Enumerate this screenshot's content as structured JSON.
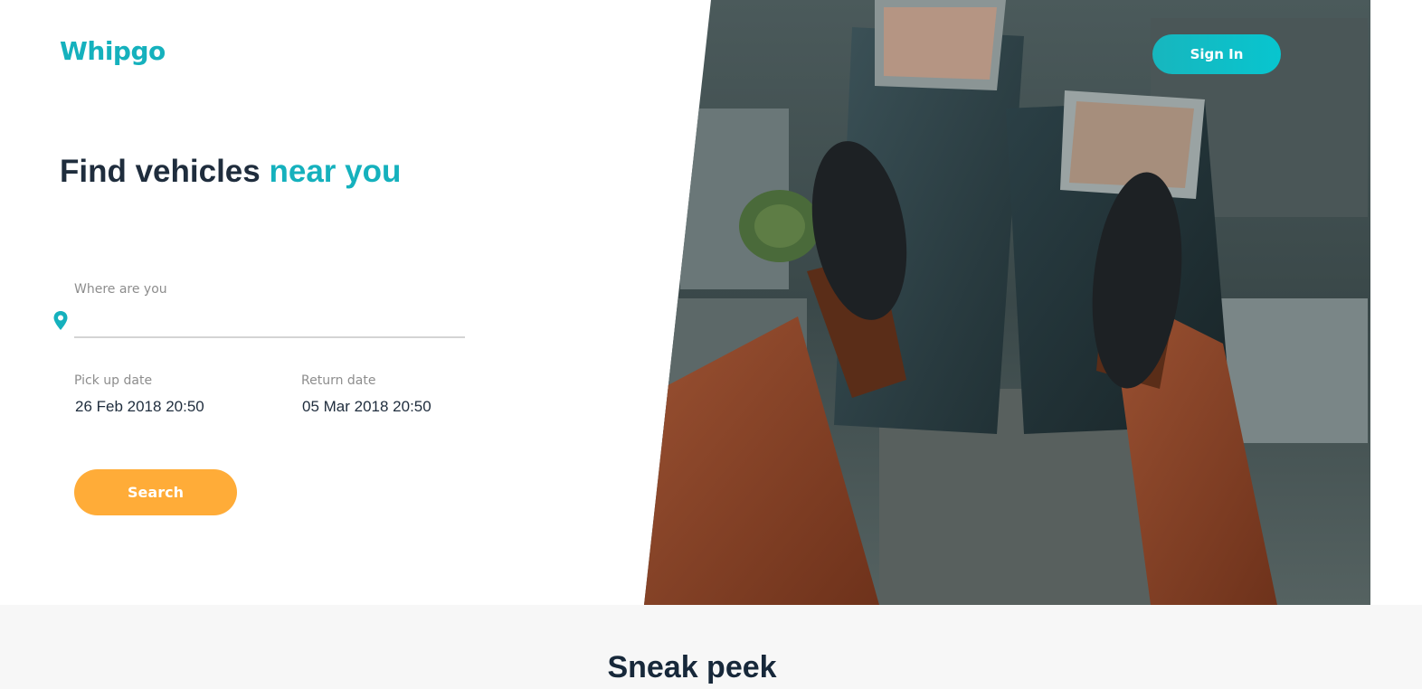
{
  "brand": {
    "logo_text": "Whipgo",
    "accent_color": "#15b1bd",
    "cta_color": "#ffac38"
  },
  "header": {
    "signin_label": "Sign In"
  },
  "hero": {
    "headline_prefix": "Find vehicles",
    "headline_accent": "near you",
    "image_description_icon": "city-rooftop-photo"
  },
  "search_form": {
    "location": {
      "label": "Where are you",
      "value": "",
      "placeholder": "",
      "icon": "map-pin-icon"
    },
    "pickup": {
      "label": "Pick up date",
      "value": "26 Feb 2018 20:50"
    },
    "return": {
      "label": "Return date",
      "value": "05 Mar 2018 20:50"
    },
    "search_label": "Search"
  },
  "sneak_peek": {
    "title": "Sneak peek"
  }
}
